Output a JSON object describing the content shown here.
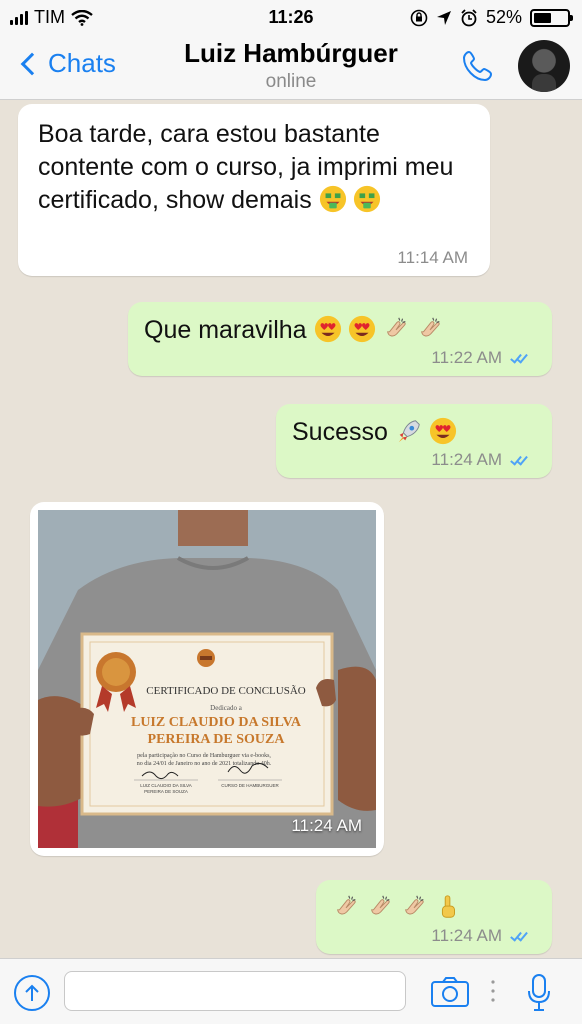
{
  "status_bar": {
    "carrier": "TIM",
    "time": "11:26",
    "battery": "52%",
    "battery_level": 0.52
  },
  "header": {
    "back_label": "Chats",
    "contact_name": "Luiz Hambúrguer",
    "contact_status": "online"
  },
  "messages": [
    {
      "direction": "in",
      "text": "Boa tarde, cara estou bastante contente com o curso, ja imprimi meu certificado, show demais",
      "emojis": [
        "money-mouth-face",
        "money-mouth-face"
      ],
      "time": "11:14 AM"
    },
    {
      "direction": "out",
      "text": "Que maravilha",
      "emojis": [
        "heart-eyes-face",
        "heart-eyes-face",
        "clapping-hands",
        "clapping-hands"
      ],
      "time": "11:22 AM",
      "status": "read"
    },
    {
      "direction": "out",
      "text": "Sucesso",
      "emojis": [
        "rocket",
        "heart-eyes-face"
      ],
      "time": "11:24 AM",
      "status": "read"
    },
    {
      "direction": "in",
      "type": "photo",
      "time": "11:24 AM",
      "photo": {
        "certificate_title": "CERTIFICADO DE CONCLUSÃO",
        "certificate_dedicated": "Dedicado a",
        "certificate_name_line1": "LUIZ CLAUDIO DA SILVA",
        "certificate_name_line2": "PEREIRA DE SOUZA",
        "certificate_body_line1": "pela participação no Curso de Hamburguer via e-books,",
        "certificate_body_line2": "no dia 24/01 de Janeiro no ano de 2021 totalizando 40h.",
        "sig_left_line1": "LUIZ CLAUDIO DA SILVA",
        "sig_left_line2": "PEREIRA DE SOUZA",
        "sig_right": "CURSO DE HAMBURGUER"
      }
    },
    {
      "direction": "out",
      "text": "",
      "emojis": [
        "clapping-hands",
        "clapping-hands",
        "clapping-hands",
        "index-pointing-up"
      ],
      "time": "11:24 AM",
      "status": "read"
    }
  ],
  "input": {
    "placeholder": ""
  },
  "colors": {
    "accent": "#1a80f0",
    "outgoing_bubble": "#dcf8c6",
    "incoming_bubble": "#ffffff",
    "chat_background": "#e8e2d8",
    "read_ticks": "#4fa3f7"
  },
  "icons": {
    "status": [
      "signal-icon",
      "wifi-icon",
      "orientation-lock-icon",
      "location-icon",
      "alarm-icon",
      "battery-icon"
    ],
    "header": [
      "chevron-left-icon",
      "phone-icon",
      "avatar"
    ],
    "input_bar": [
      "upload-icon",
      "camera-icon",
      "more-dots-icon",
      "microphone-icon"
    ]
  }
}
